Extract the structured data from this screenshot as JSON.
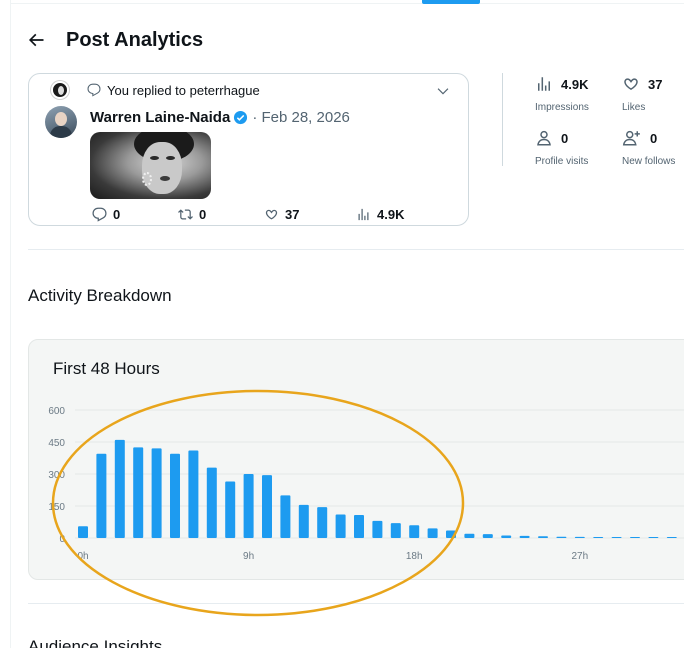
{
  "header": {
    "title": "Post Analytics",
    "back_icon": "arrow-left-icon"
  },
  "post": {
    "reply_context": "You replied to peterrhague",
    "author_name": "Warren Laine-Naida",
    "date": "· Feb 28, 2026",
    "verified": true,
    "replies": "0",
    "reposts": "0",
    "likes": "37",
    "views": "4.9K"
  },
  "stats": {
    "impressions": {
      "value": "4.9K",
      "label": "Impressions",
      "icon": "bar-chart-icon"
    },
    "likes": {
      "value": "37",
      "label": "Likes",
      "icon": "heart-icon"
    },
    "profile_visits": {
      "value": "0",
      "label": "Profile visits",
      "icon": "person-icon"
    },
    "new_follows": {
      "value": "0",
      "label": "New follows",
      "icon": "person-add-icon"
    }
  },
  "sections": {
    "activity": "Activity Breakdown",
    "audience": "Audience Insights"
  },
  "colors": {
    "accent": "#1d9bf0",
    "annotation": "#e8a51c"
  },
  "chart_data": {
    "type": "bar",
    "title": "First 48 Hours",
    "xlabel": "",
    "ylabel": "",
    "ylim": [
      0,
      600
    ],
    "yticks": [
      0,
      150,
      300,
      450,
      600
    ],
    "ytick_labels": [
      "0",
      "150",
      "300",
      "450",
      "600"
    ],
    "xtick_labels": [
      {
        "label": "0h",
        "index": 0
      },
      {
        "label": "9h",
        "index": 9
      },
      {
        "label": "18h",
        "index": 18
      },
      {
        "label": "27h",
        "index": 27
      }
    ],
    "grid": true,
    "values": [
      55,
      395,
      460,
      425,
      420,
      395,
      410,
      330,
      265,
      300,
      295,
      200,
      155,
      145,
      110,
      108,
      80,
      70,
      60,
      45,
      35,
      20,
      18,
      12,
      10,
      8,
      6,
      5,
      4,
      3,
      3,
      2,
      2,
      2
    ]
  }
}
